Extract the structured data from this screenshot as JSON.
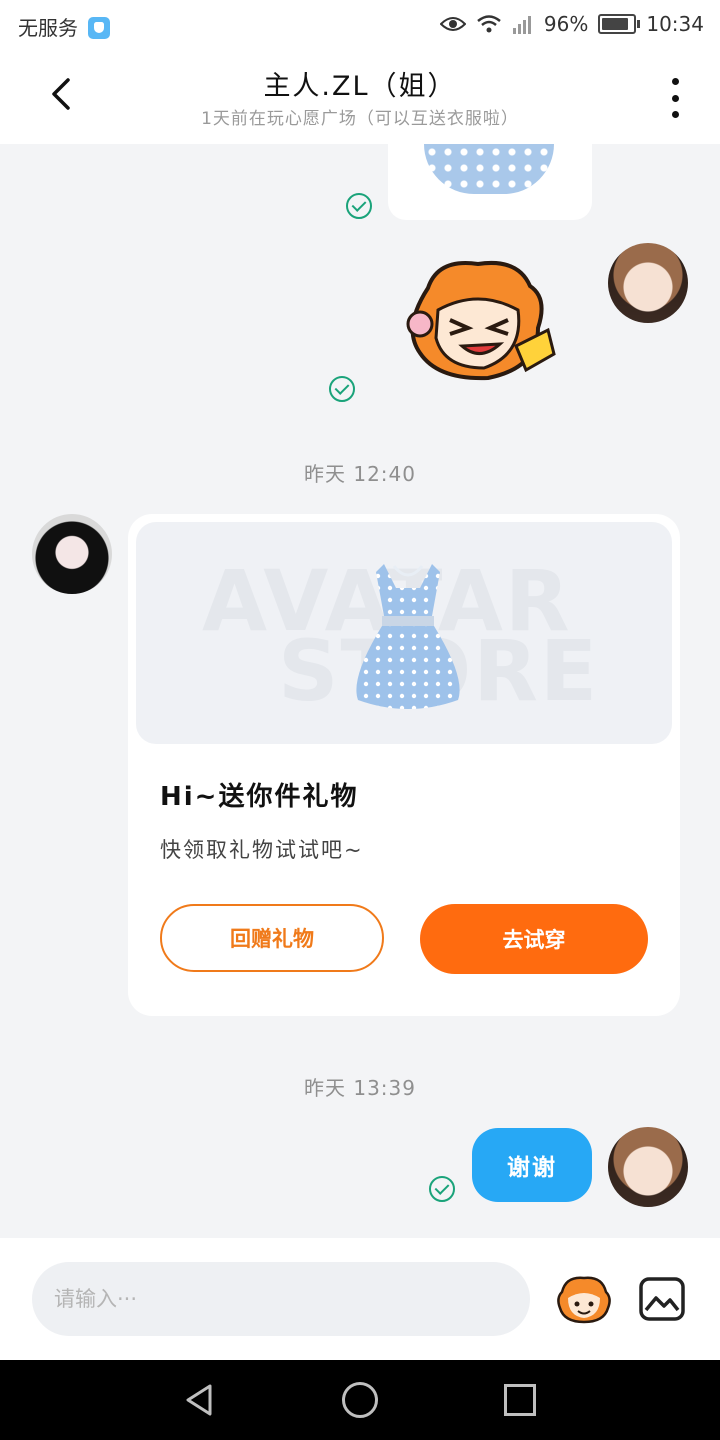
{
  "status_bar": {
    "carrier": "无服务",
    "battery": "96%",
    "time": "10:34",
    "icons": [
      "app-shield-icon",
      "eye-icon",
      "wifi-icon",
      "signal-icon",
      "battery-icon"
    ]
  },
  "header": {
    "title": "主人.ZL（姐）",
    "subtitle": "1天前在玩心愿广场（可以互送衣服啦）",
    "icons": [
      "back-arrow-icon",
      "more-vertical-icon"
    ]
  },
  "chat": {
    "timestamps": [
      "昨天 12:40",
      "昨天 13:39"
    ],
    "gift_card": {
      "watermark_line1": "AVATAR",
      "watermark_line2": "STORE",
      "title": "Hi~送你件礼物",
      "description": "快领取礼物试试吧~",
      "button_return": "回赠礼物",
      "button_try": "去试穿"
    },
    "reply_message": "谢谢",
    "accent_colors": {
      "orange": "#ff6b0f",
      "blue_bubble": "#27a8f5",
      "check_green": "#1aa37a"
    }
  },
  "input_bar": {
    "placeholder": "请输入···",
    "icons": [
      "emoji-mascot-icon",
      "image-picker-icon"
    ]
  },
  "nav_bar": {
    "icons": [
      "nav-back-icon",
      "nav-home-icon",
      "nav-recent-icon"
    ]
  }
}
